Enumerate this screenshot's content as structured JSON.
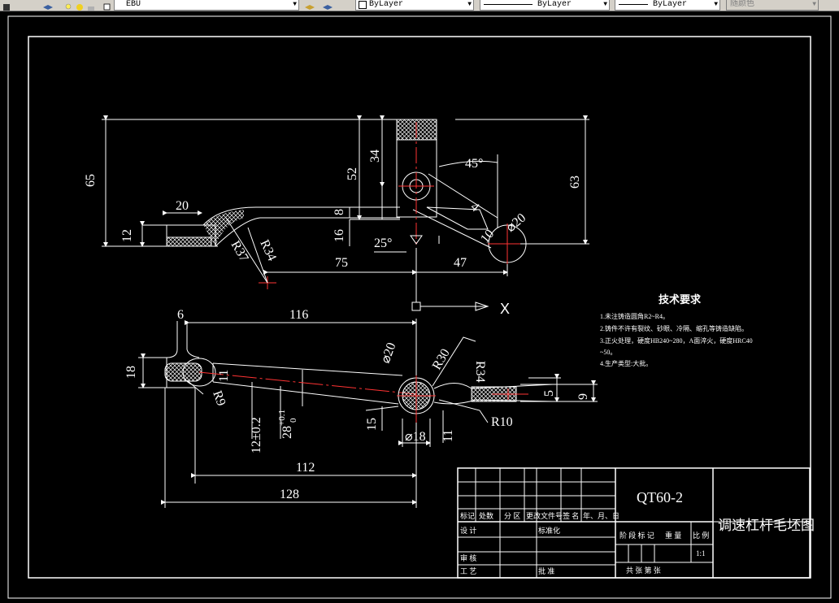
{
  "toolbar": {
    "layer_name": "EBU",
    "color_control": "ByLayer",
    "linetype_control": "ByLayer",
    "lineweight_control": "ByLayer",
    "plotstyle_control": "随颜色"
  },
  "colors": {
    "background": "#000000",
    "lines": "#ffffff",
    "center_lines": "#ff0000",
    "toolbar": "#d4d0c8"
  },
  "drawing": {
    "top_view": {
      "dims": {
        "d65": "65",
        "d20": "20",
        "d12": "12",
        "r37": "R37",
        "r34": "R34",
        "d8": "8",
        "d16": "16",
        "d75": "75",
        "d52": "52",
        "d34": "34",
        "d25": "25°",
        "d45": "45°",
        "d4": "4",
        "d10": "10",
        "dphi20": "⌀20",
        "d47": "47",
        "d63": "63"
      }
    },
    "bottom_view": {
      "dims": {
        "d6": "6",
        "d116": "116",
        "d18": "18",
        "d11": "11",
        "r9": "R9",
        "d12tol": "12±0.2",
        "d28tol": "28",
        "d28_upper": "+0.1",
        "d28_lower": "0",
        "d112": "112",
        "d128": "128",
        "d20b": "⌀20",
        "r30": "R30",
        "r34b": "R34",
        "d15": "15",
        "dphi18": "⌀18",
        "d11b": "11",
        "r10": "R10",
        "d5": "5",
        "d9": "9"
      }
    },
    "ucs_label": "X",
    "tech_requirements": {
      "title": "技术要求",
      "items": [
        "1.未注铸造圆角R2~R4。",
        "2.铸件不许有裂纹、砂眼、冷隔、缩孔等铸造缺陷。",
        "3.正火处理，硬度HB240~280，A面淬火，硬度HRC40",
        "~50。",
        "4.生产类型:大批。"
      ]
    },
    "title_block": {
      "material": "QT60-2",
      "drawing_name": "调速杠杆毛坯图",
      "h_mark": "标记",
      "h_count": "处数",
      "h_zone": "分 区",
      "h_doc": "更改文件号",
      "h_sign": "签 名",
      "h_date": "年、月、日",
      "design": "设 计",
      "standardize": "标准化",
      "stage_mark": "阶 段 标 记",
      "weight": "重 量",
      "scale_label": "比 例",
      "scale_value": "1:1",
      "review": "审 核",
      "process": "工 艺",
      "approve": "批 准",
      "total_sheets": "共 张 第 张"
    }
  }
}
